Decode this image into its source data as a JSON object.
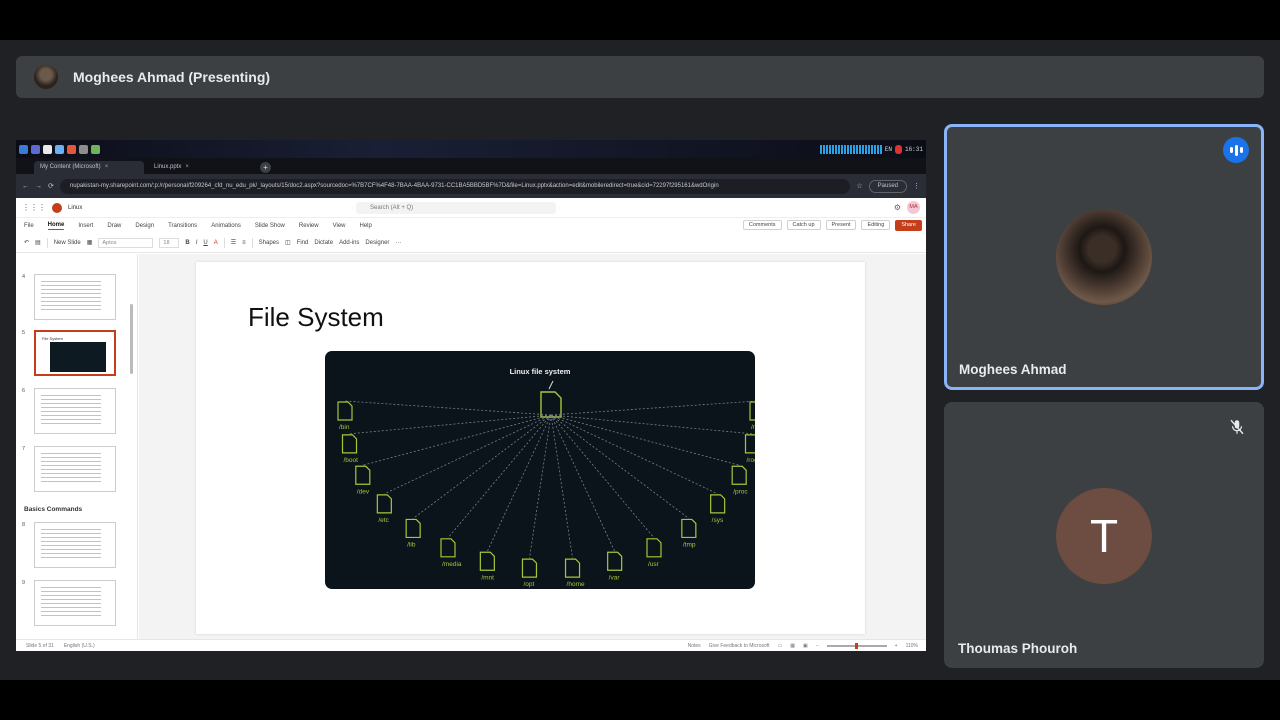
{
  "presenter": {
    "name": "Moghees Ahmad (Presenting)"
  },
  "taskbar": {
    "lang": "EN",
    "time": "16:31"
  },
  "browser": {
    "tabs": [
      {
        "label": "My Content (Microsoft)",
        "active": true
      },
      {
        "label": "Linux.pptx",
        "active": false
      }
    ],
    "url": "nupakistan-my.sharepoint.com/:p:/r/personal/f209264_cfd_nu_edu_pk/_layouts/15/doc2.aspx?sourcedoc=%7B7CF%4F48-7BAA-4BAA-9731-CC1BA5BBD5BF%7D&file=Linux.pptx&action=edit&mobileredirect=true&cid=72297f295161&wdOrigin",
    "paused": "Paused"
  },
  "ppt": {
    "doc_name": "Linux",
    "search_placeholder": "Search (Alt + Q)",
    "avatar_initials": "MA",
    "ribbon_tabs": [
      "File",
      "Home",
      "Insert",
      "Draw",
      "Design",
      "Transitions",
      "Animations",
      "Slide Show",
      "Review",
      "View",
      "Help"
    ],
    "ribbon_right": [
      "Comments",
      "Catch up",
      "Present",
      "Editing"
    ],
    "share": "Share",
    "toolbar": {
      "new_slide": "New Slide",
      "font": "Aptos",
      "size": "18",
      "shapes": "Shapes",
      "find": "Find",
      "dictate": "Dictate",
      "addins": "Add-ins",
      "designer": "Designer"
    },
    "thumbnails": [
      {
        "num": "4",
        "title": "",
        "type": "text"
      },
      {
        "num": "5",
        "title": "File System",
        "type": "image",
        "selected": true
      },
      {
        "num": "6",
        "title": "",
        "type": "text"
      },
      {
        "num": "7",
        "title": "",
        "type": "text"
      },
      {
        "num": "8",
        "title": "",
        "type": "text"
      },
      {
        "num": "9",
        "title": "",
        "type": "text"
      }
    ],
    "section_label": "Basics Commands",
    "slide": {
      "title": "File System",
      "diagram_heading": "Linux file system",
      "dirs": [
        "/bin",
        "/boot",
        "/dev",
        "/etc",
        "/lib",
        "/media",
        "/mnt",
        "/opt",
        "/home",
        "/var",
        "/usr",
        "/tmp",
        "/sys",
        "/proc",
        "/root",
        "/run"
      ]
    },
    "status": {
      "slide_of": "Slide 5 of 31",
      "lang": "English (U.S.)",
      "notes": "Notes",
      "feedback": "Give Feedback to Microsoft",
      "zoom": "110%"
    }
  },
  "participants": [
    {
      "name": "Moghees Ahmad",
      "speaking": true
    },
    {
      "name": "Thoumas Phouroh",
      "initial": "T",
      "muted": true
    }
  ],
  "colors": {
    "accent_blue": "#8ab4f8",
    "ppt_orange": "#c43e1c",
    "diagram_green": "#a4c639",
    "avatar_brown": "#6d4c41"
  }
}
